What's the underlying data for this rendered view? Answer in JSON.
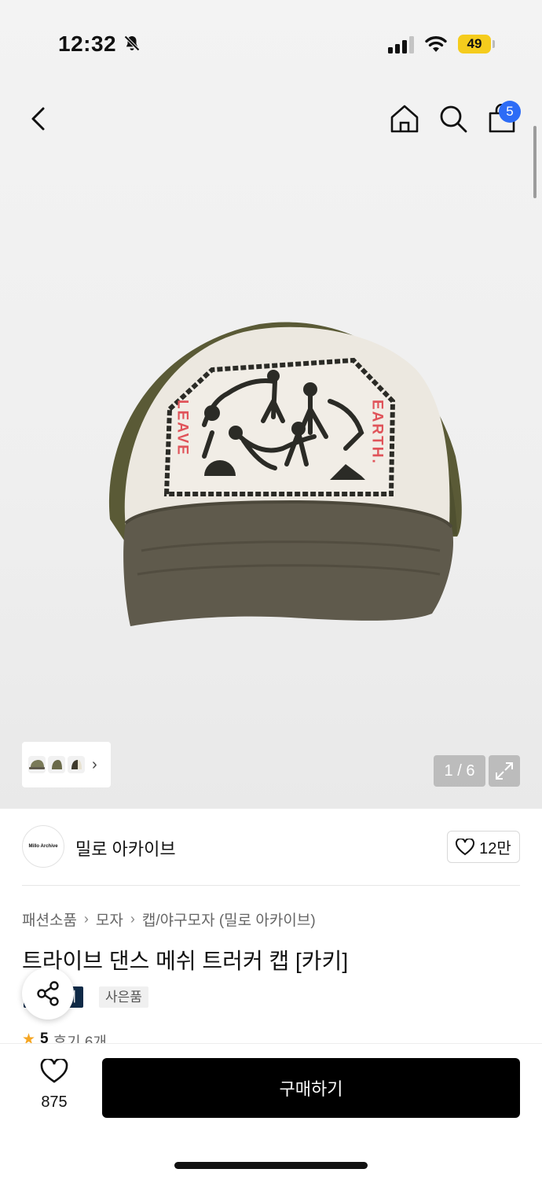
{
  "status_bar": {
    "time": "12:32",
    "battery": "49"
  },
  "nav": {
    "cart_count": "5"
  },
  "gallery": {
    "counter": "1 / 6"
  },
  "seller": {
    "logo_text": "Millo Archive",
    "name": "밀로 아카이브",
    "likes": "12만"
  },
  "breadcrumb": [
    "패션소품",
    "모자",
    "캡/야구모자 (밀로 아카이브)"
  ],
  "product": {
    "title": "트라이브 댄스 메쉬 트러커 캡 [카키]",
    "tags": [
      "이",
      "사은품"
    ],
    "rating": {
      "score": "5",
      "reviews": "후기 6개"
    },
    "cap_print": {
      "left": "LEAVE",
      "right": "EARTH."
    }
  },
  "bottom": {
    "wish_count": "875",
    "buy_label": "구매하기"
  },
  "colors": {
    "accent_badge": "#2d6cf6",
    "buy_button": "#000000",
    "battery": "#f5cc1d",
    "tag_dark": "#0f2a47",
    "star": "#f5a623"
  }
}
